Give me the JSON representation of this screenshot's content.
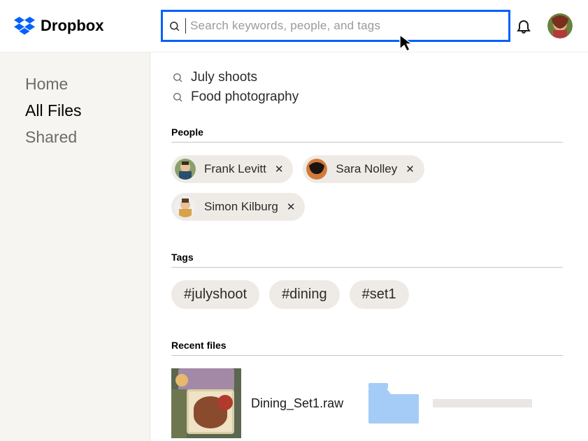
{
  "brand": {
    "name": "Dropbox"
  },
  "search": {
    "placeholder": "Search keywords, people, and tags"
  },
  "sidebar": {
    "items": [
      {
        "label": "Home",
        "active": false
      },
      {
        "label": "All Files",
        "active": true
      },
      {
        "label": "Shared",
        "active": false
      }
    ]
  },
  "suggestions": [
    {
      "label": "July shoots"
    },
    {
      "label": "Food photography"
    }
  ],
  "sections": {
    "people": "People",
    "tags": "Tags",
    "recent": "Recent files"
  },
  "people": [
    {
      "name": "Frank Levitt"
    },
    {
      "name": "Sara Nolley"
    },
    {
      "name": "Simon Kilburg"
    }
  ],
  "tags": [
    {
      "label": "#julyshoot"
    },
    {
      "label": "#dining"
    },
    {
      "label": "#set1"
    }
  ],
  "recent_files": [
    {
      "name": "Dining_Set1.raw",
      "kind": "image"
    },
    {
      "name": "",
      "kind": "folder"
    }
  ],
  "icons": {
    "close_glyph": "✕"
  }
}
